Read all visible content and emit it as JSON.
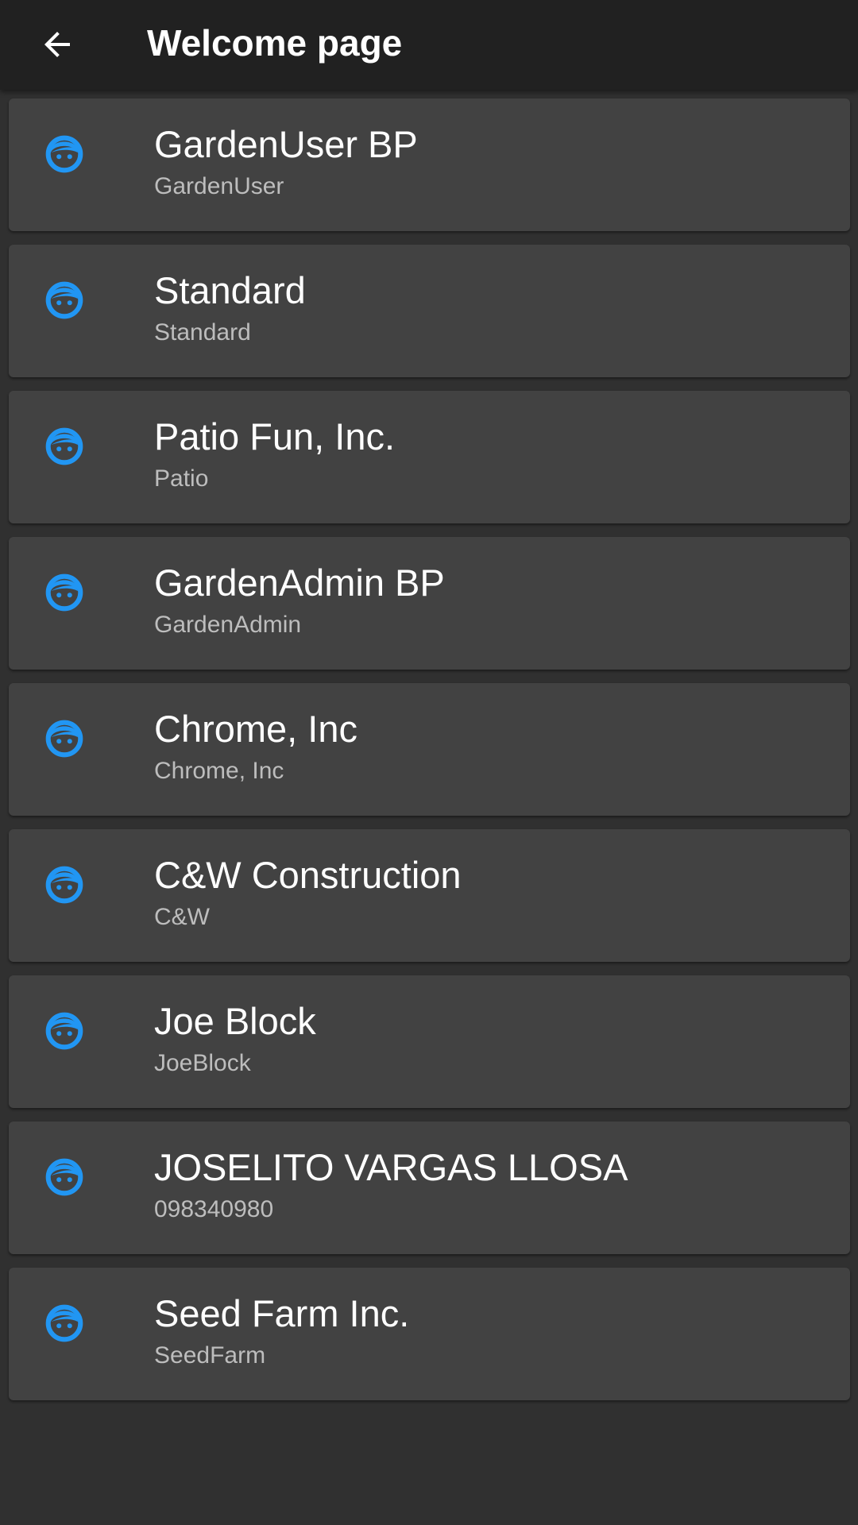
{
  "app_bar": {
    "title": "Welcome page",
    "back_icon": "arrow-left-icon"
  },
  "theme": {
    "accent": "#2196f3",
    "app_bar_bg": "#212121",
    "page_bg": "#303030",
    "card_bg": "#424242",
    "subtitle_color": "#bdbdbd"
  },
  "accounts": [
    {
      "name": "GardenUser BP",
      "id": "GardenUser",
      "icon": "face-icon"
    },
    {
      "name": "Standard",
      "id": "Standard",
      "icon": "face-icon"
    },
    {
      "name": "Patio Fun, Inc.",
      "id": "Patio",
      "icon": "face-icon"
    },
    {
      "name": "GardenAdmin BP",
      "id": "GardenAdmin",
      "icon": "face-icon"
    },
    {
      "name": "Chrome, Inc",
      "id": "Chrome, Inc",
      "icon": "face-icon"
    },
    {
      "name": "C&W Construction",
      "id": "C&W",
      "icon": "face-icon"
    },
    {
      "name": "Joe Block",
      "id": "JoeBlock",
      "icon": "face-icon"
    },
    {
      "name": "JOSELITO VARGAS LLOSA",
      "id": "098340980",
      "icon": "face-icon"
    },
    {
      "name": "Seed Farm Inc.",
      "id": "SeedFarm",
      "icon": "face-icon"
    }
  ]
}
